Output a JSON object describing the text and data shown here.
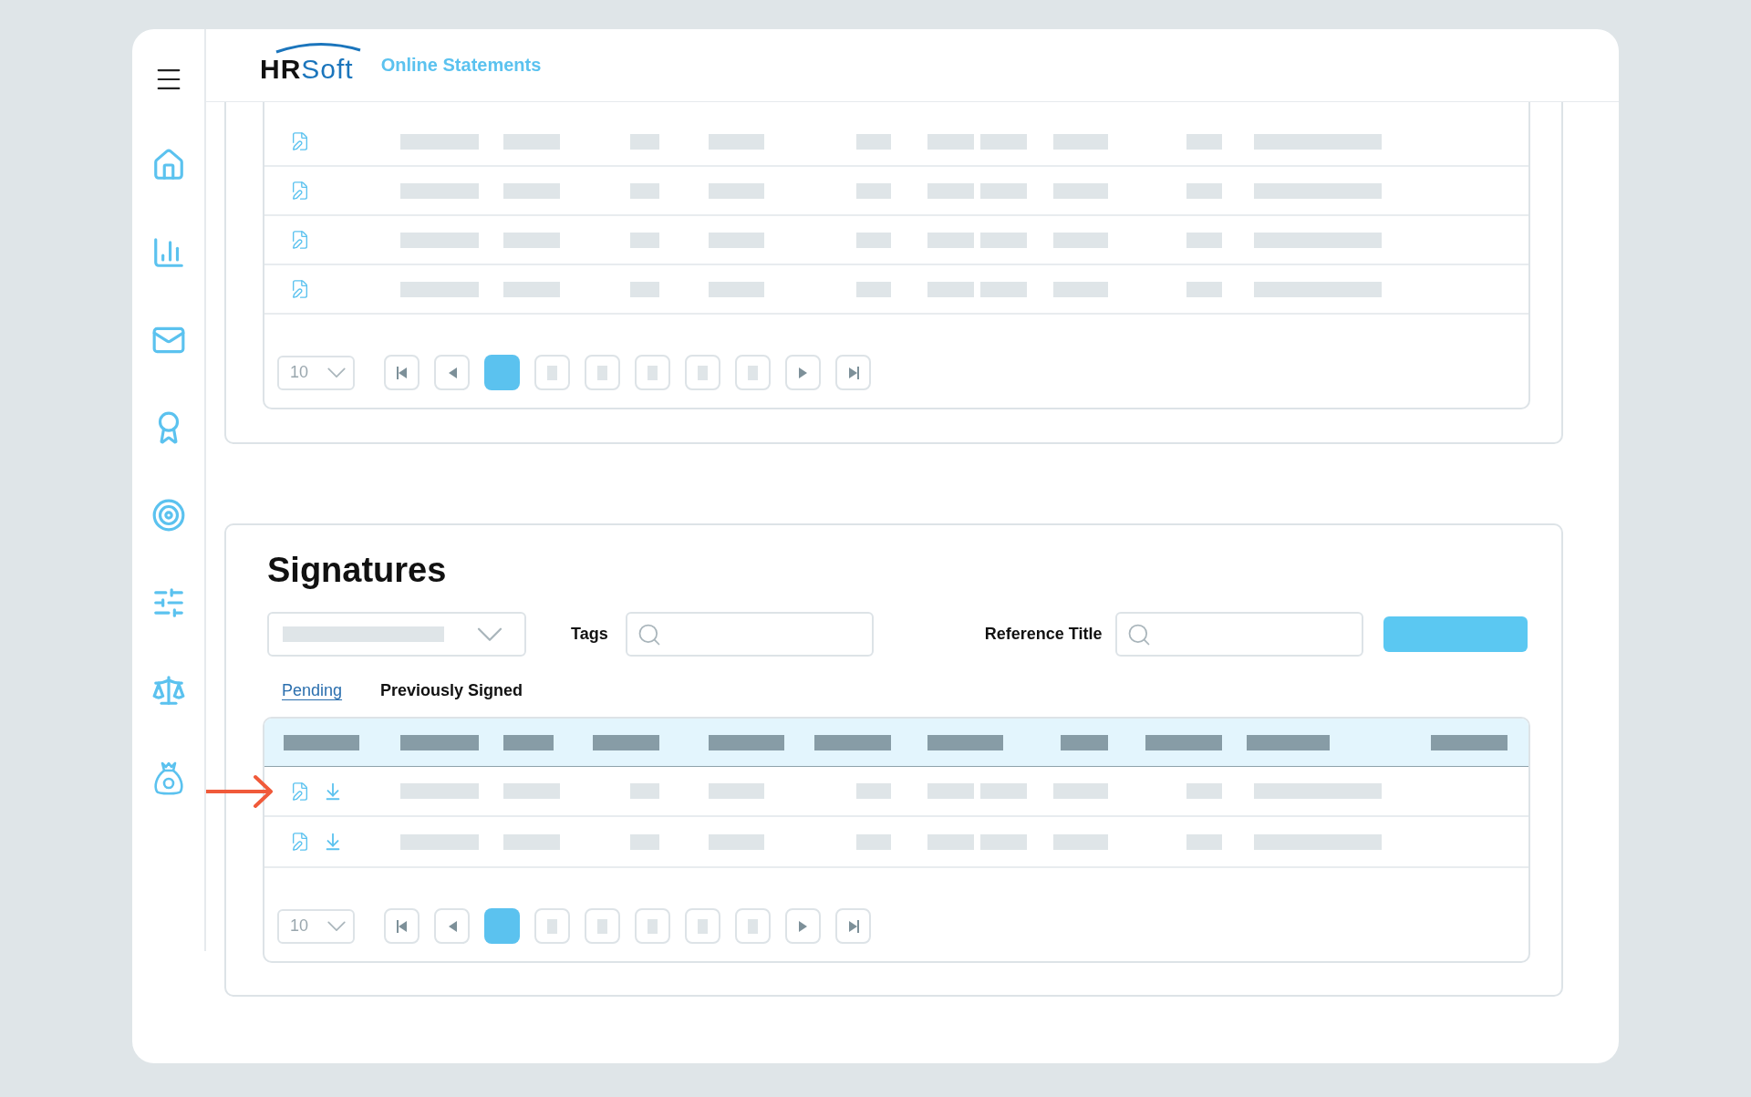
{
  "header": {
    "logo": "**HR**Soft",
    "title": "Online Statements"
  },
  "statements_table": {
    "per_page": "10",
    "pages": [
      {
        "selected": true
      },
      {
        "selected": false
      },
      {
        "selected": false
      },
      {
        "selected": false
      },
      {
        "selected": false
      },
      {
        "selected": false
      }
    ]
  },
  "signatures": {
    "title": "Signatures",
    "tags_label": "Tags",
    "reference_title_label": "Reference Title",
    "tabs": [
      {
        "label": "Pending",
        "selected": true
      },
      {
        "label": "Previously Signed",
        "selected": false
      }
    ],
    "table": {
      "per_page": "10",
      "pages": [
        {
          "selected": true
        },
        {
          "selected": false
        },
        {
          "selected": false
        },
        {
          "selected": false
        },
        {
          "selected": false
        },
        {
          "selected": false
        }
      ]
    }
  }
}
